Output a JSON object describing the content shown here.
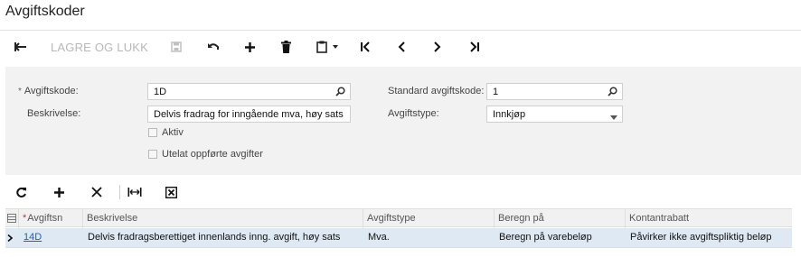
{
  "page": {
    "title": "Avgiftskoder"
  },
  "toolbar": {
    "save_close_label": "LAGRE OG LUKK",
    "icons": [
      "back-arrow",
      "save",
      "undo",
      "add",
      "delete",
      "copy-paste",
      "first",
      "previous",
      "next",
      "last"
    ]
  },
  "form": {
    "tax_code_label": "Avgiftskode:",
    "tax_code_value": "1D",
    "description_label": "Beskrivelse:",
    "description_value": "Delvis fradrag for inngående mva, høy sats",
    "active_label": "Aktiv",
    "exclude_label": "Utelat oppførte avgifter",
    "standard_code_label": "Standard avgiftskode:",
    "standard_code_value": "1",
    "tax_type_label": "Avgiftstype:",
    "tax_type_value": "Innkjøp"
  },
  "grid": {
    "columns": [
      "Avgiftsn",
      "Beskrivelse",
      "Avgiftstype",
      "Beregn på",
      "Kontantrabatt"
    ],
    "rows": [
      {
        "code": "14D",
        "description": "Delvis fradragsberettiget innenlands inng. avgift, høy sats",
        "tax_type": "Mva.",
        "calc_on": "Beregn på varebeløp",
        "cash_discount": "Påvirker ikke avgiftspliktig beløp"
      }
    ]
  },
  "colors": {
    "accent_link": "#1f62b5",
    "form_bg": "#f2f2f2",
    "selected_row": "#dfe9f4"
  }
}
